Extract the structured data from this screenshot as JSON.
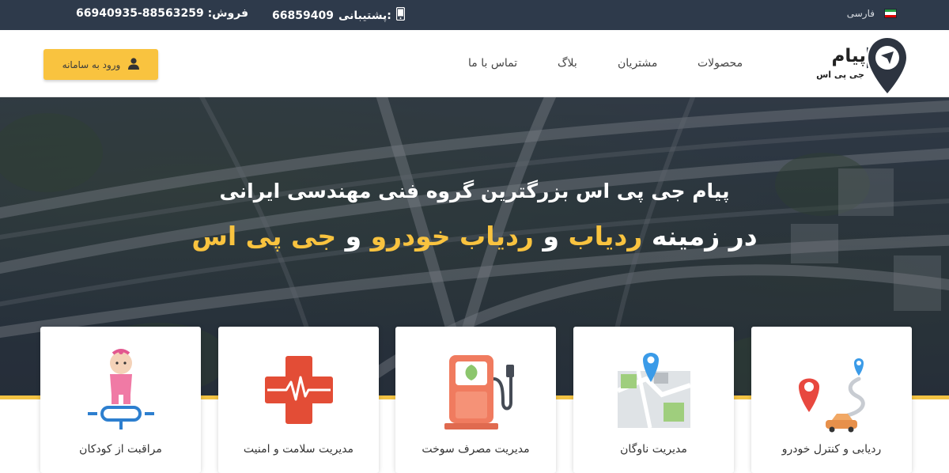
{
  "topbar": {
    "sales_label": "فروش:",
    "sales_numbers": "88563259-66940935",
    "support_label": "پشتیبانی:",
    "support_number": "66859409",
    "phone_icon": "mobile-phone-icon",
    "language": "فارسی",
    "flag_icon": "iran-flag-icon"
  },
  "header": {
    "logo_name": "پیام",
    "logo_sub": "جی پی اس",
    "logo_icon": "location-pin-arrow-icon",
    "nav": [
      {
        "label": "محصولات"
      },
      {
        "label": "مشتریان"
      },
      {
        "label": "بلاگ"
      },
      {
        "label": "تماس با ما"
      }
    ],
    "login_label": "ورود به سامانه",
    "login_icon": "user-icon"
  },
  "hero": {
    "line1": "پیام جی پی اس بزرگترین گروه فنی مهندسی ایرانی",
    "line2_prefix": "در زمینه",
    "line2_hl1": "ردیاب",
    "line2_and1": "و",
    "line2_hl2": "ردیاب خودرو",
    "line2_and2": "و",
    "line2_hl3": "جی پی اس",
    "highlight_color": "#f9c33f"
  },
  "services": [
    {
      "label": "ردیابی و کنترل خودرو",
      "icon": "vehicle-tracking-route-icon"
    },
    {
      "label": "مدیریت ناوگان",
      "icon": "fleet-map-pin-icon"
    },
    {
      "label": "مدیریت مصرف سوخت",
      "icon": "fuel-pump-icon"
    },
    {
      "label": "مدیریت سلامت و امنیت",
      "icon": "health-cross-icon"
    },
    {
      "label": "مراقبت از کودکان",
      "icon": "child-care-icon"
    }
  ],
  "colors": {
    "topbar_bg": "#2e3a4b",
    "accent": "#f9c33f"
  }
}
